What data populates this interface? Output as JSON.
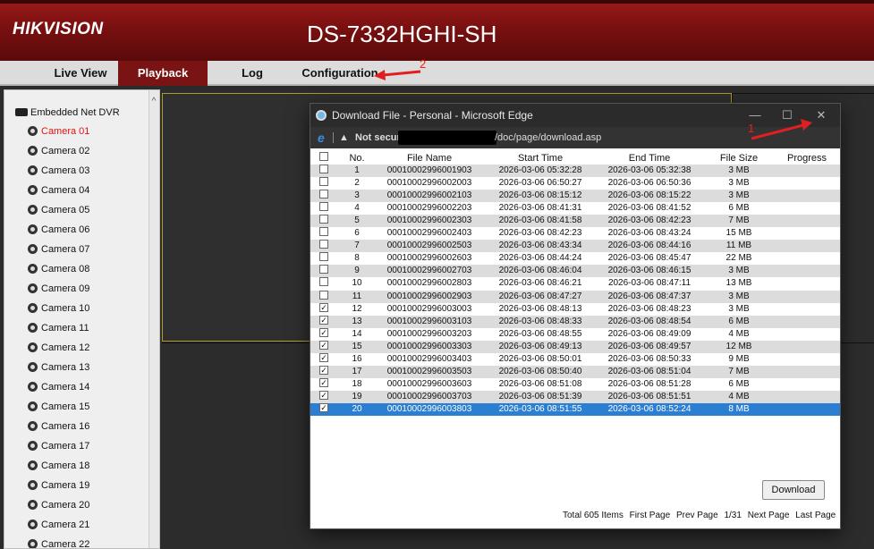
{
  "header": {
    "brand": "HIKVISION",
    "device_name": "DS-7332HGHI-SH"
  },
  "nav": {
    "live_view": "Live View",
    "playback": "Playback",
    "log": "Log",
    "configuration": "Configuration"
  },
  "sidebar": {
    "root": "Embedded Net DVR",
    "cameras": [
      "Camera 01",
      "Camera 02",
      "Camera 03",
      "Camera 04",
      "Camera 05",
      "Camera 06",
      "Camera 07",
      "Camera 08",
      "Camera 09",
      "Camera 10",
      "Camera 11",
      "Camera 12",
      "Camera 13",
      "Camera 14",
      "Camera 15",
      "Camera 16",
      "Camera 17",
      "Camera 18",
      "Camera 19",
      "Camera 20",
      "Camera 21",
      "Camera 22"
    ],
    "active": "Camera 01"
  },
  "annotations": {
    "one": "1",
    "two": "2",
    "color": "#e02020"
  },
  "window": {
    "title": "Download File - Personal - Microsoft Edge",
    "security": "Not secure",
    "url": "/doc/page/download.asp",
    "controls": {
      "minimize": "—",
      "maximize": "☐",
      "close": "✕"
    }
  },
  "table": {
    "columns": [
      "No.",
      "File Name",
      "Start Time",
      "End Time",
      "File Size",
      "Progress"
    ],
    "rows": [
      {
        "no": "1",
        "file": "00010002996001903",
        "start": "2026-03-06 05:32:28",
        "end": "2026-03-06 05:32:38",
        "size": "3 MB",
        "checked": false
      },
      {
        "no": "2",
        "file": "00010002996002003",
        "start": "2026-03-06 06:50:27",
        "end": "2026-03-06 06:50:36",
        "size": "3 MB",
        "checked": false
      },
      {
        "no": "3",
        "file": "00010002996002103",
        "start": "2026-03-06 08:15:12",
        "end": "2026-03-06 08:15:22",
        "size": "3 MB",
        "checked": false
      },
      {
        "no": "4",
        "file": "00010002996002203",
        "start": "2026-03-06 08:41:31",
        "end": "2026-03-06 08:41:52",
        "size": "6 MB",
        "checked": false
      },
      {
        "no": "5",
        "file": "00010002996002303",
        "start": "2026-03-06 08:41:58",
        "end": "2026-03-06 08:42:23",
        "size": "7 MB",
        "checked": false
      },
      {
        "no": "6",
        "file": "00010002996002403",
        "start": "2026-03-06 08:42:23",
        "end": "2026-03-06 08:43:24",
        "size": "15 MB",
        "checked": false
      },
      {
        "no": "7",
        "file": "00010002996002503",
        "start": "2026-03-06 08:43:34",
        "end": "2026-03-06 08:44:16",
        "size": "11 MB",
        "checked": false
      },
      {
        "no": "8",
        "file": "00010002996002603",
        "start": "2026-03-06 08:44:24",
        "end": "2026-03-06 08:45:47",
        "size": "22 MB",
        "checked": false
      },
      {
        "no": "9",
        "file": "00010002996002703",
        "start": "2026-03-06 08:46:04",
        "end": "2026-03-06 08:46:15",
        "size": "3 MB",
        "checked": false
      },
      {
        "no": "10",
        "file": "00010002996002803",
        "start": "2026-03-06 08:46:21",
        "end": "2026-03-06 08:47:11",
        "size": "13 MB",
        "checked": false
      },
      {
        "no": "11",
        "file": "00010002996002903",
        "start": "2026-03-06 08:47:27",
        "end": "2026-03-06 08:47:37",
        "size": "3 MB",
        "checked": false
      },
      {
        "no": "12",
        "file": "00010002996003003",
        "start": "2026-03-06 08:48:13",
        "end": "2026-03-06 08:48:23",
        "size": "3 MB",
        "checked": true
      },
      {
        "no": "13",
        "file": "00010002996003103",
        "start": "2026-03-06 08:48:33",
        "end": "2026-03-06 08:48:54",
        "size": "6 MB",
        "checked": true
      },
      {
        "no": "14",
        "file": "00010002996003203",
        "start": "2026-03-06 08:48:55",
        "end": "2026-03-06 08:49:09",
        "size": "4 MB",
        "checked": true
      },
      {
        "no": "15",
        "file": "00010002996003303",
        "start": "2026-03-06 08:49:13",
        "end": "2026-03-06 08:49:57",
        "size": "12 MB",
        "checked": true
      },
      {
        "no": "16",
        "file": "00010002996003403",
        "start": "2026-03-06 08:50:01",
        "end": "2026-03-06 08:50:33",
        "size": "9 MB",
        "checked": true
      },
      {
        "no": "17",
        "file": "00010002996003503",
        "start": "2026-03-06 08:50:40",
        "end": "2026-03-06 08:51:04",
        "size": "7 MB",
        "checked": true
      },
      {
        "no": "18",
        "file": "00010002996003603",
        "start": "2026-03-06 08:51:08",
        "end": "2026-03-06 08:51:28",
        "size": "6 MB",
        "checked": true
      },
      {
        "no": "19",
        "file": "00010002996003703",
        "start": "2026-03-06 08:51:39",
        "end": "2026-03-06 08:51:51",
        "size": "4 MB",
        "checked": true
      },
      {
        "no": "20",
        "file": "00010002996003803",
        "start": "2026-03-06 08:51:55",
        "end": "2026-03-06 08:52:24",
        "size": "8 MB",
        "checked": true,
        "selected": true
      }
    ]
  },
  "download_button": "Download",
  "pagination": {
    "total": "Total 605 Items",
    "first": "First Page",
    "prev": "Prev Page",
    "page": "1/31",
    "next": "Next Page",
    "last": "Last Page"
  }
}
